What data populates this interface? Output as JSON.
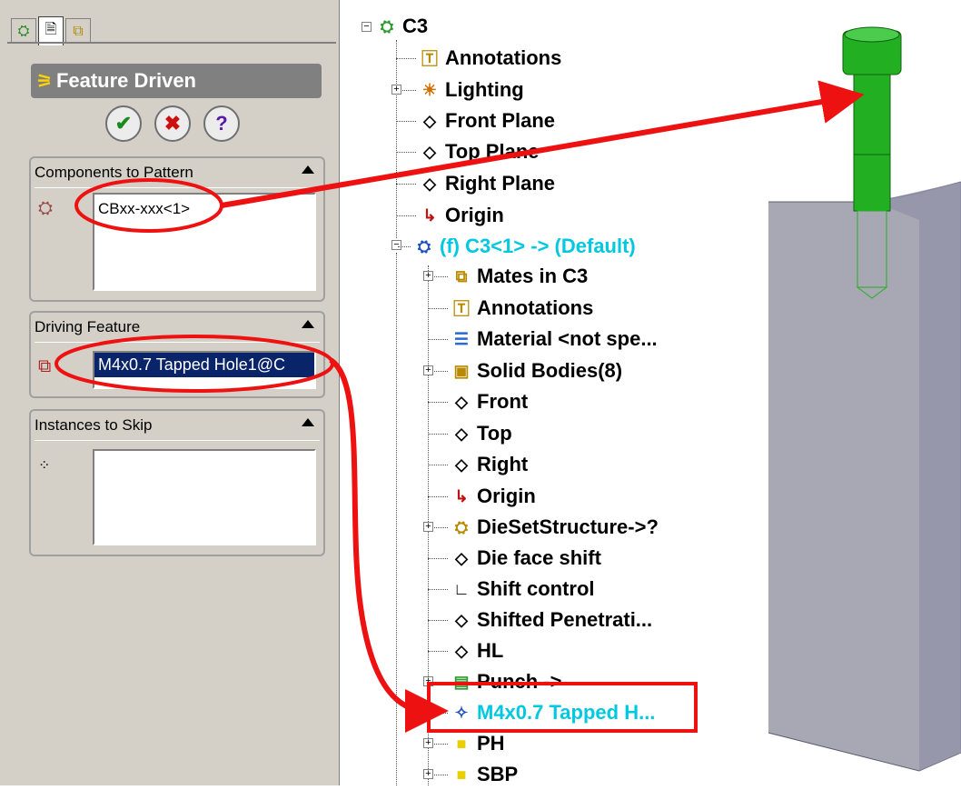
{
  "tabs": [
    {
      "icon": "feature-manager-icon"
    },
    {
      "icon": "property-manager-icon"
    },
    {
      "icon": "configuration-manager-icon"
    }
  ],
  "property_manager": {
    "title": "Feature Driven",
    "buttons": {
      "ok": "✔",
      "cancel": "✖",
      "help": "?"
    },
    "components_group": {
      "title": "Components to Pattern",
      "value": "CBxx-xxx<1>"
    },
    "driving_group": {
      "title": "Driving Feature",
      "value": "M4x0.7 Tapped Hole1@C"
    },
    "skip_group": {
      "title": "Instances to Skip",
      "value": ""
    }
  },
  "tree": {
    "root": "C3",
    "top_items": [
      "Annotations",
      "Lighting",
      "Front Plane",
      "Top Plane",
      "Right Plane",
      "Origin"
    ],
    "component": "(f) C3<1> -> (Default)",
    "component_items": [
      "Mates in C3",
      "Annotations",
      "Material <not spe...",
      "Solid Bodies(8)",
      "Front",
      "Top",
      "Right",
      "Origin",
      "DieSetStructure->?",
      "Die face shift",
      "Shift control",
      "Shifted Penetrati...",
      "HL",
      "Punch ->",
      "M4x0.7 Tapped H...",
      "PH",
      "SBP"
    ]
  },
  "colors": {
    "panel_bg": "#d4d0c8",
    "selection": "#0a246a",
    "highlight_cyan": "#00c8e0",
    "callout_red": "#ee1111",
    "screw_green": "#22b022",
    "block_gray": "#a8a8b4"
  }
}
